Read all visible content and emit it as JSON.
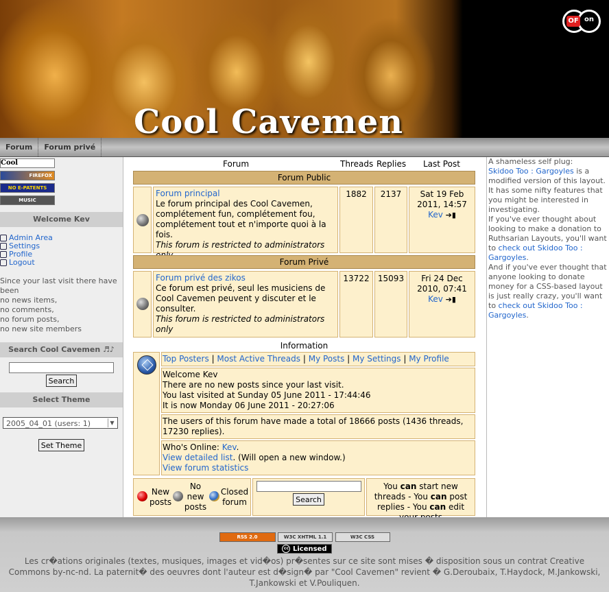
{
  "banner": {
    "title": "Cool Cavemen",
    "logo_left": "OF",
    "logo_right": "on"
  },
  "nav": [
    {
      "label": "Forum"
    },
    {
      "label": "Forum privé"
    }
  ],
  "left": {
    "badges": [
      "Cool Cavemen",
      "FIREFOX",
      "NO E-PATENTS",
      "MUSIC"
    ],
    "welcome_title": "Welcome Kev",
    "links": [
      "Admin Area",
      "Settings",
      "Profile",
      "Logout"
    ],
    "since_lines": [
      "Since your last visit there have been",
      "no news items,",
      "no comments,",
      "no forum posts,",
      "no new site members"
    ],
    "search_title": "Search Cool Cavemen",
    "search_button": "Search",
    "theme_title": "Select Theme",
    "theme_selected": "2005_04_01 (users: 1)",
    "theme_button": "Set Theme"
  },
  "forum": {
    "headers": {
      "forum": "Forum",
      "threads": "Threads",
      "replies": "Replies",
      "last_post": "Last Post"
    },
    "categories": [
      {
        "title": "Forum Public",
        "forum_name": "Forum principal",
        "description": "Le forum principal des Cool Cavemen, complétement fun, complétement fou, complétement tout et n'importe quoi à la fois.",
        "restricted": "This forum is restricted to administrators only",
        "threads": "1882",
        "replies": "2137",
        "last_date": "Sat 19 Feb 2011, 14:57",
        "last_user": "Kev"
      },
      {
        "title": "Forum Privé",
        "forum_name": "Forum privé des zikos",
        "description": "Ce forum est privé, seul les musiciens de Cool Cavemen peuvent y discuter et le consulter.",
        "restricted": "This forum is restricted to administrators only",
        "threads": "13722",
        "replies": "15093",
        "last_date": "Fri 24 Dec 2010, 07:41",
        "last_user": "Kev"
      }
    ],
    "info_title": "Information",
    "info_links": [
      "Top Posters",
      "Most Active Threads",
      "My Posts",
      "My Settings",
      "My Profile"
    ],
    "welcome_lines": [
      "Welcome Kev",
      "There are no new posts since your last visit.",
      "You last visited at Sunday 05 June 2011 - 17:44:46",
      "It is now Monday 06 June 2011 - 20:27:06"
    ],
    "total_posts": "The users of this forum have made a total of 18666 posts (1436 threads, 17230 replies).",
    "online_label": "Who's Online:",
    "online_user": "Kev",
    "detailed_list": "View detailed list",
    "detailed_note": ". (Will open a new window.)",
    "statistics": "View forum statistics",
    "legend": {
      "new": "New posts",
      "no_new": "No new posts",
      "closed": "Closed forum"
    },
    "search_button": "Search",
    "perm_lines": [
      "You can start new threads",
      "You can post replies",
      "You can edit your posts"
    ]
  },
  "right": {
    "intro": "A shameless self plug:",
    "link1": "Skidoo Too : Gargoyles",
    "text1": " is a modified version of this layout. It has some nifty features that you might be interested in investigating.",
    "text2": "If you've ever thought about looking to make a donation to Ruthsarian Layouts, you'll want to ",
    "link2": "check out Skidoo Too : Gargoyles",
    "text3": "And if you've ever thought that anyone looking to donate money for a CSS-based layout is just really crazy, you'll want to ",
    "link3": "check out Skidoo Too : Gargoyles"
  },
  "footer": {
    "badges": [
      "RSS 2.0",
      "W3C XHTML 1.1",
      "W3C CSS"
    ],
    "license": "Licensed",
    "text": "Les cr�ations originales (textes, musiques, images et vid�os) pr�sentes sur ce site sont mises � disposition sous un contrat Creative Commons by-nc-nd. La paternit� des oeuvres dont l'auteur est d�sign� par \"Cool Cavemen\" revient � G.Deroubaix, T.Haydock, M.Jankowski, T.Jankowski et V.Pouliquen."
  }
}
